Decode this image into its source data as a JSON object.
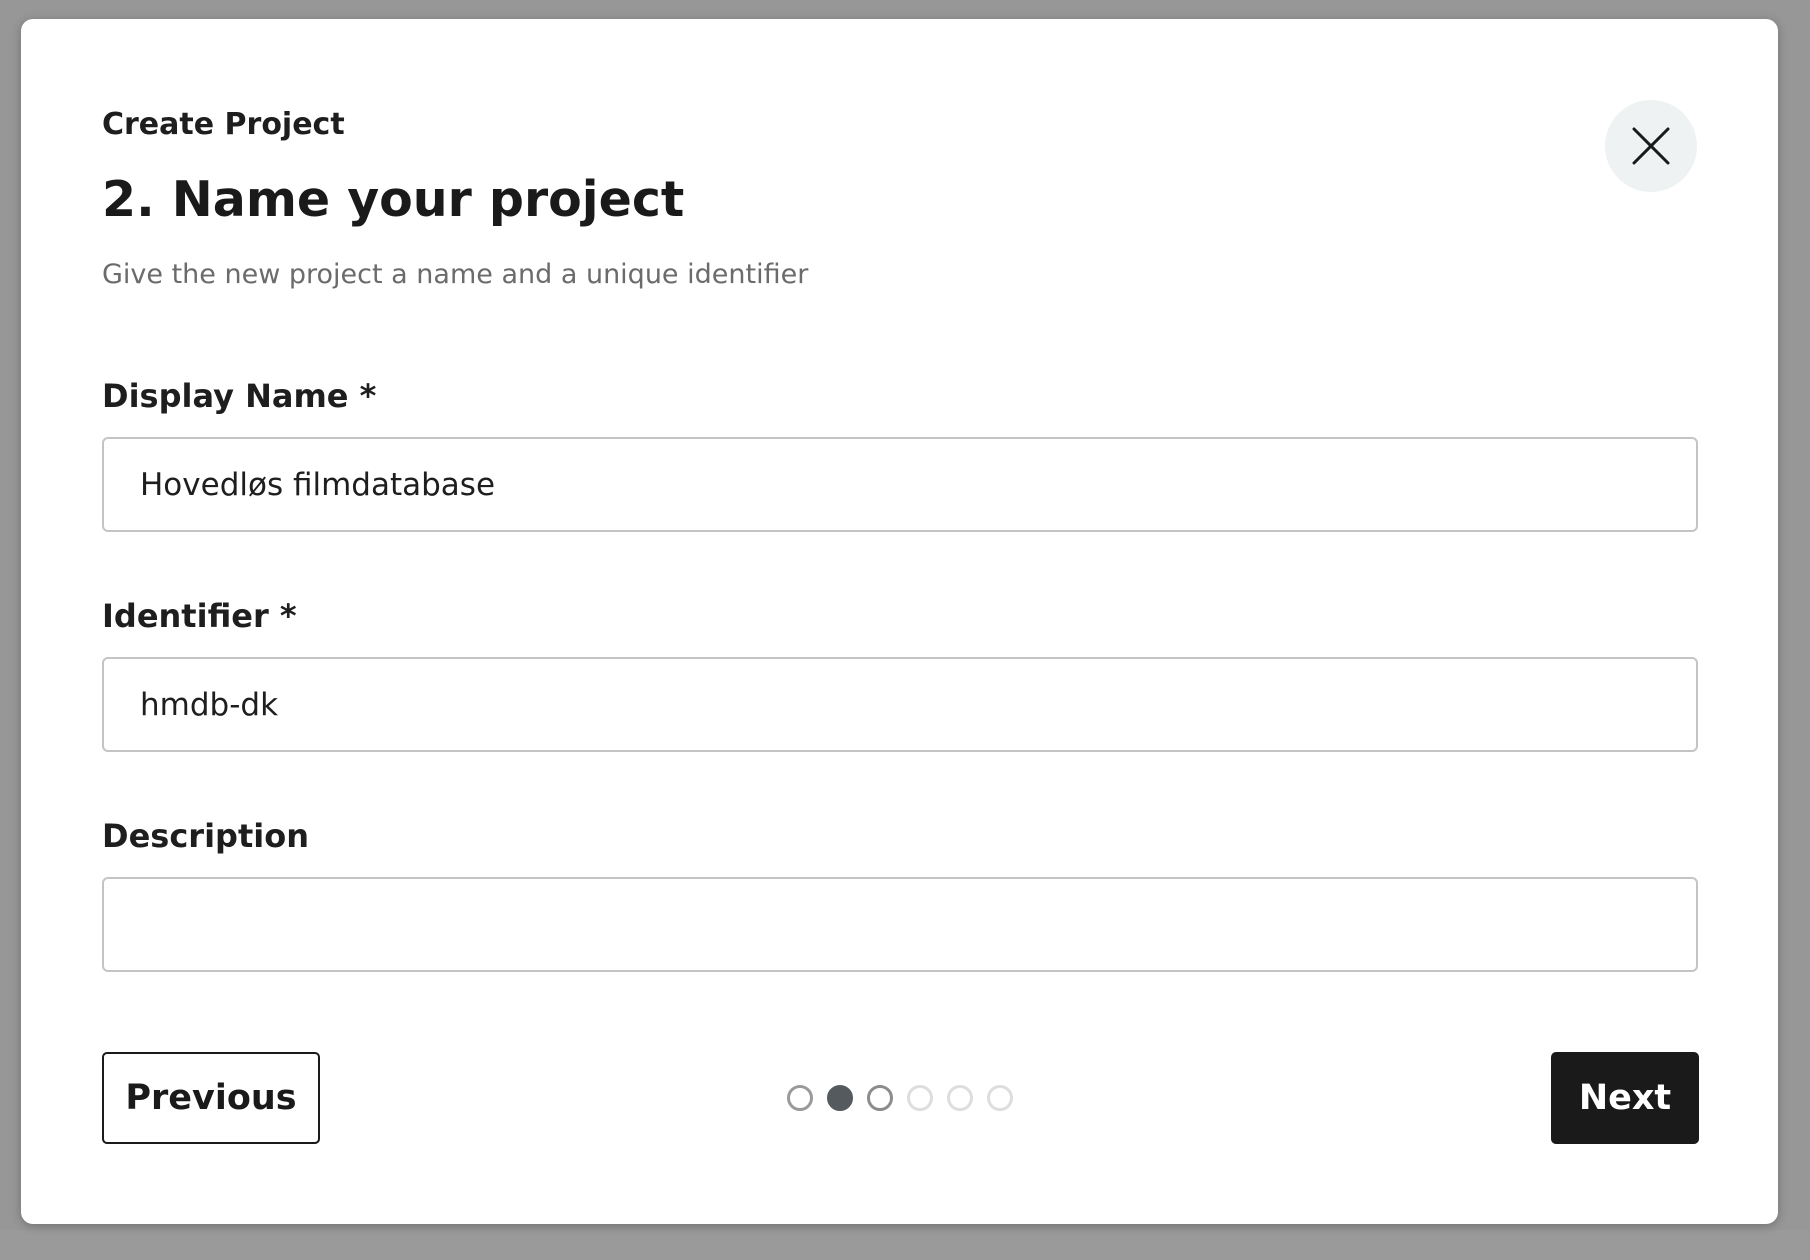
{
  "modal": {
    "overline": "Create Project",
    "title": "2. Name your project",
    "subtitle": "Give the new project a name and a unique identifier"
  },
  "fields": {
    "display_name": {
      "label": "Display Name *",
      "value": "Hovedløs filmdatabase"
    },
    "identifier": {
      "label": "Identifier *",
      "value": "hmdb-dk"
    },
    "description": {
      "label": "Description",
      "value": ""
    }
  },
  "footer": {
    "previous_label": "Previous",
    "next_label": "Next"
  },
  "stepper": {
    "total_steps": 6,
    "current_step": 2
  },
  "icons": {
    "close": "close-icon"
  }
}
